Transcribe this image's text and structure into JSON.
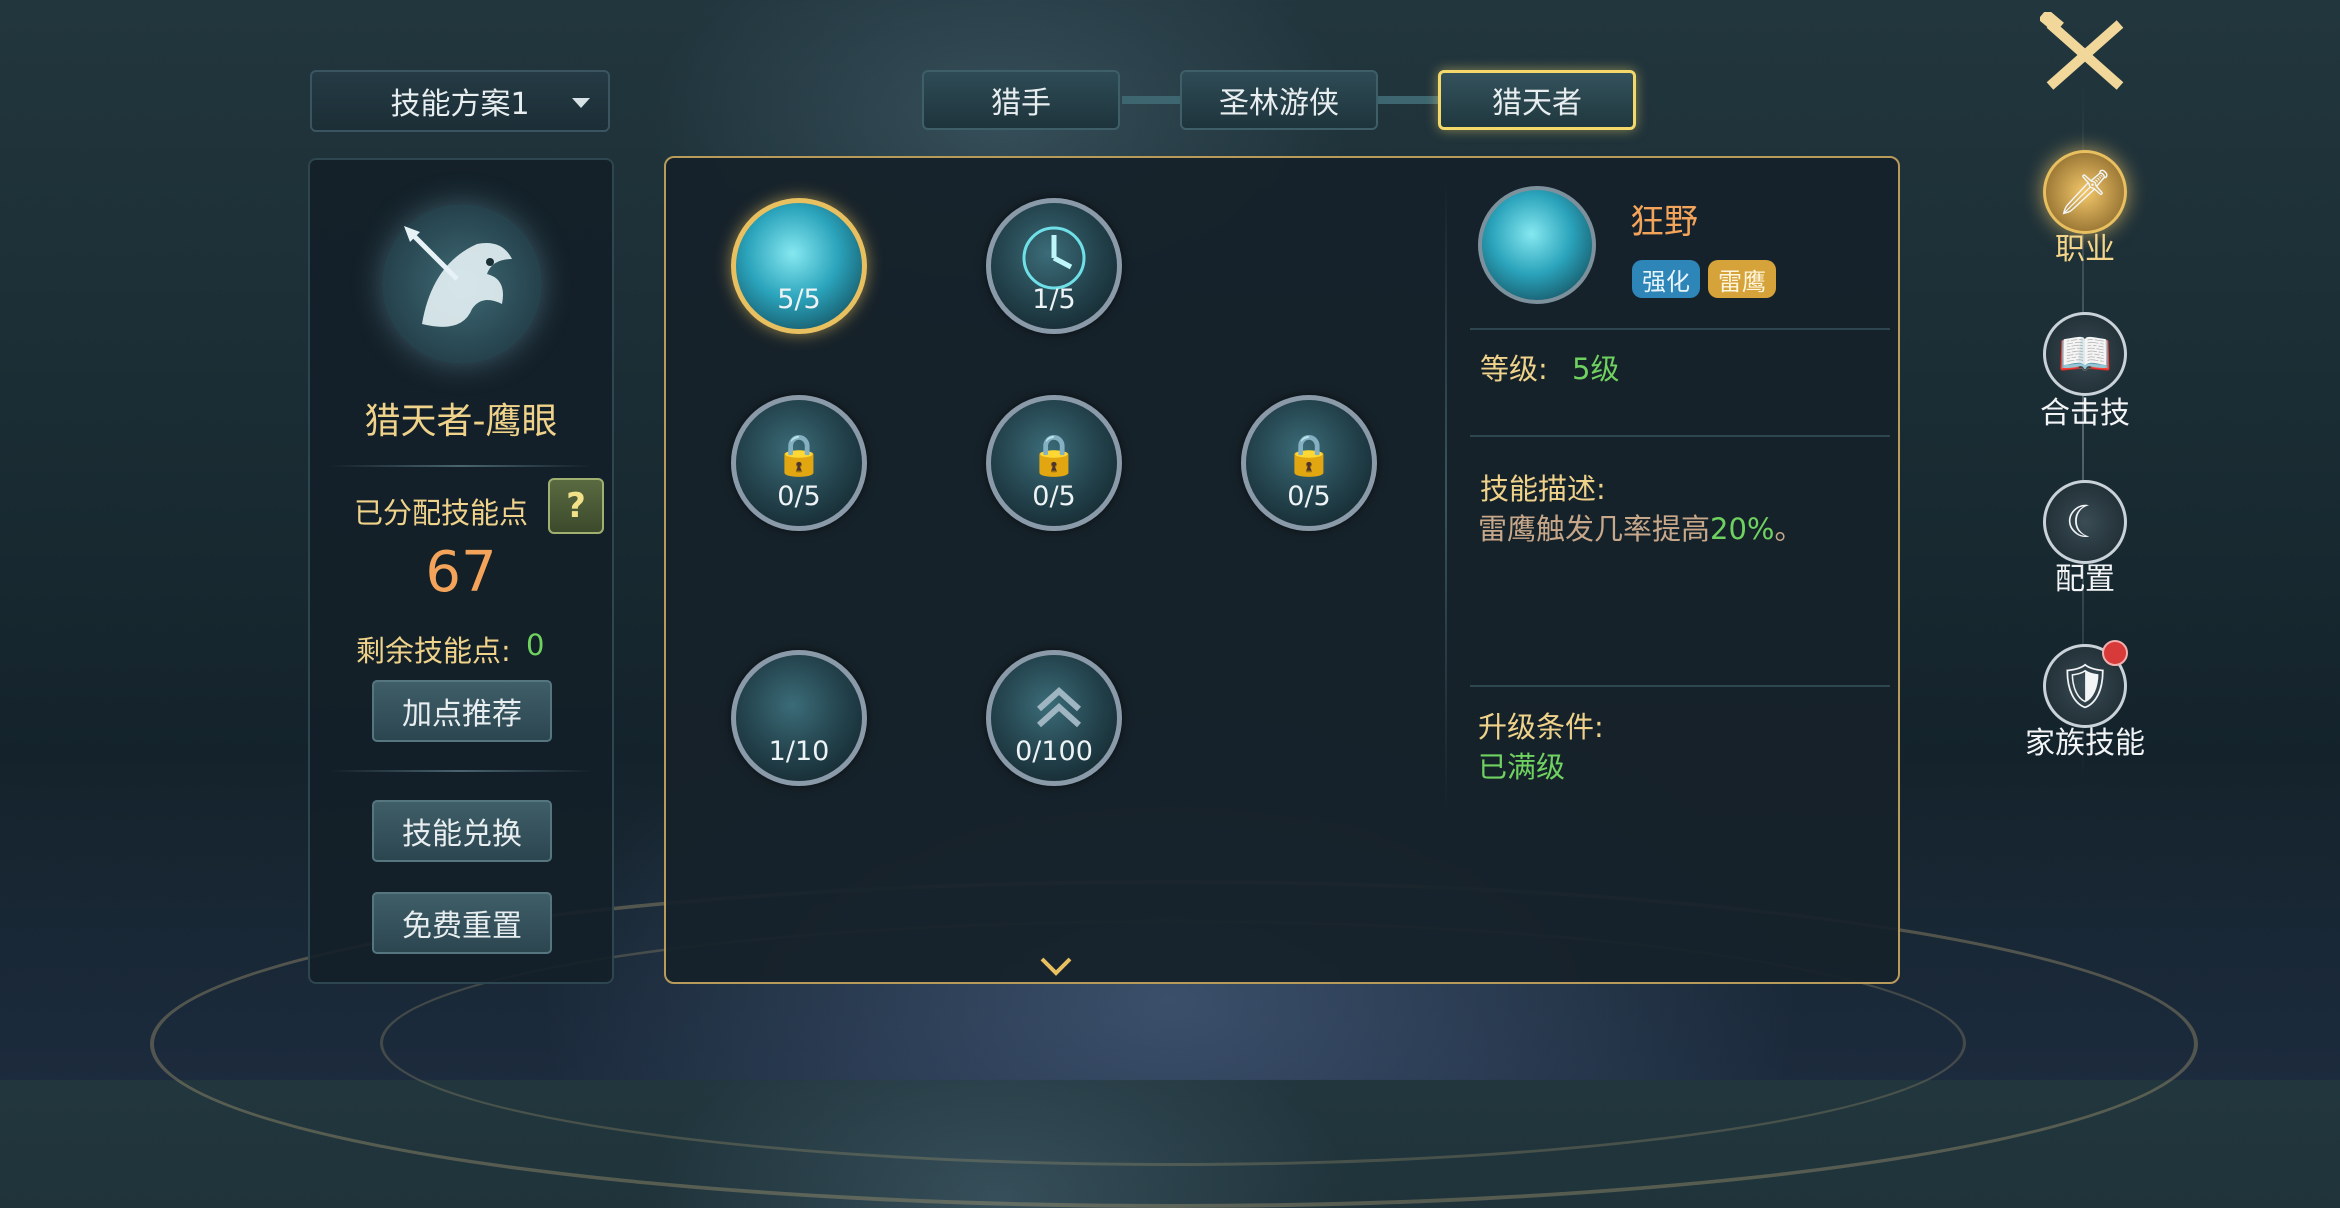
{
  "plan_selector": {
    "label": "技能方案1"
  },
  "tabs": [
    {
      "label": "猎手",
      "active": false
    },
    {
      "label": "圣林游侠",
      "active": false
    },
    {
      "label": "猎天者",
      "active": true
    }
  ],
  "left_panel": {
    "class_name": "猎天者-鹰眼",
    "allocated_label": "已分配技能点",
    "help_label": "?",
    "allocated_points": "67",
    "remaining_label": "剩余技能点:",
    "remaining_value": "0",
    "buttons": {
      "recommend": "加点推荐",
      "exchange": "技能兑换",
      "reset": "免费重置"
    }
  },
  "skills": [
    {
      "count": "5/5",
      "locked": false,
      "selected": true
    },
    {
      "count": "1/5",
      "locked": false,
      "selected": false
    },
    {
      "count": "0/5",
      "locked": true,
      "selected": false
    },
    {
      "count": "0/5",
      "locked": true,
      "selected": false
    },
    {
      "count": "0/5",
      "locked": true,
      "selected": false
    },
    {
      "count": "1/10",
      "locked": false,
      "selected": false
    },
    {
      "count": "0/100",
      "locked": false,
      "selected": false
    }
  ],
  "detail": {
    "name": "狂野",
    "tags": [
      "强化",
      "雷鹰"
    ],
    "level_label": "等级:",
    "level_value": "5级",
    "desc_label": "技能描述:",
    "desc_text": "雷鹰触发几率提高",
    "desc_highlight": "20%",
    "desc_end": "。",
    "upgrade_label": "升级条件:",
    "upgrade_value": "已满级"
  },
  "right_nav": [
    {
      "label": "",
      "icon": "close-swords-icon"
    },
    {
      "label": "职业",
      "icon": "sword-emblem-icon",
      "active": true
    },
    {
      "label": "合击技",
      "icon": "book-icon"
    },
    {
      "label": "配置",
      "icon": "moon-star-icon"
    },
    {
      "label": "家族技能",
      "icon": "wolf-crest-icon",
      "badge": true
    }
  ],
  "colors": {
    "accent_gold": "#f5d86a",
    "green": "#6fd160",
    "orange": "#f4a45a"
  }
}
